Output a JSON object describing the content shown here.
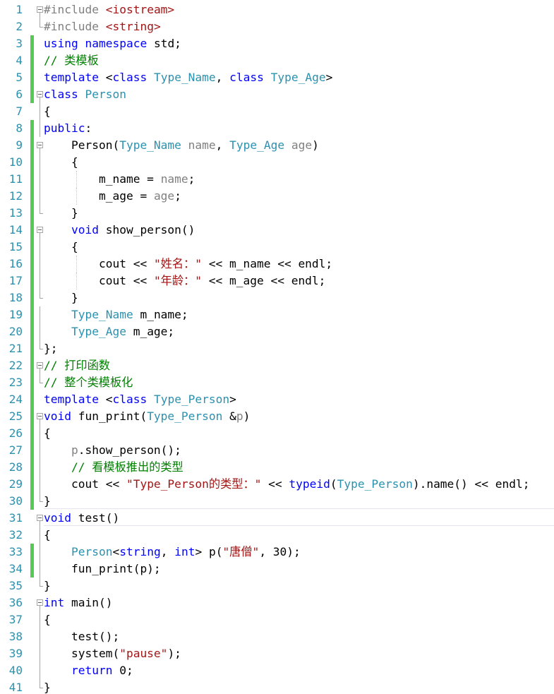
{
  "editor": {
    "lines": [
      {
        "n": "1",
        "changed": false,
        "fold": "box",
        "parts": [
          {
            "c": "pp",
            "t": "#include "
          },
          {
            "c": "str",
            "t": "<iostream>"
          }
        ]
      },
      {
        "n": "2",
        "changed": false,
        "fold": "end",
        "parts": [
          {
            "c": "pp",
            "t": "#include "
          },
          {
            "c": "str",
            "t": "<string>"
          }
        ]
      },
      {
        "n": "3",
        "changed": true,
        "fold": "",
        "parts": [
          {
            "c": "kw",
            "t": "using"
          },
          {
            "c": "",
            "t": " "
          },
          {
            "c": "kw",
            "t": "namespace"
          },
          {
            "c": "",
            "t": " std;"
          }
        ]
      },
      {
        "n": "4",
        "changed": true,
        "fold": "",
        "parts": [
          {
            "c": "cm",
            "t": "// 类模板"
          }
        ]
      },
      {
        "n": "5",
        "changed": true,
        "fold": "",
        "parts": [
          {
            "c": "kw",
            "t": "template"
          },
          {
            "c": "",
            "t": " <"
          },
          {
            "c": "kw",
            "t": "class"
          },
          {
            "c": "",
            "t": " "
          },
          {
            "c": "ty",
            "t": "Type_Name"
          },
          {
            "c": "",
            "t": ", "
          },
          {
            "c": "kw",
            "t": "class"
          },
          {
            "c": "",
            "t": " "
          },
          {
            "c": "ty",
            "t": "Type_Age"
          },
          {
            "c": "",
            "t": ">"
          }
        ]
      },
      {
        "n": "6",
        "changed": true,
        "fold": "box",
        "parts": [
          {
            "c": "kw",
            "t": "class"
          },
          {
            "c": "",
            "t": " "
          },
          {
            "c": "ty",
            "t": "Person"
          }
        ]
      },
      {
        "n": "7",
        "changed": false,
        "fold": "line",
        "parts": [
          {
            "c": "",
            "t": "{"
          }
        ]
      },
      {
        "n": "8",
        "changed": true,
        "fold": "line",
        "parts": [
          {
            "c": "kw",
            "t": "public"
          },
          {
            "c": "",
            "t": ":"
          }
        ]
      },
      {
        "n": "9",
        "changed": true,
        "fold": "box",
        "parts": [
          {
            "c": "",
            "t": "    Person("
          },
          {
            "c": "ty",
            "t": "Type_Name"
          },
          {
            "c": "",
            "t": " "
          },
          {
            "c": "pa",
            "t": "name"
          },
          {
            "c": "",
            "t": ", "
          },
          {
            "c": "ty",
            "t": "Type_Age"
          },
          {
            "c": "",
            "t": " "
          },
          {
            "c": "pa",
            "t": "age"
          },
          {
            "c": "",
            "t": ")"
          }
        ]
      },
      {
        "n": "10",
        "changed": true,
        "fold": "line",
        "parts": [
          {
            "c": "",
            "t": "    {"
          }
        ]
      },
      {
        "n": "11",
        "changed": true,
        "fold": "line",
        "guide": 1,
        "parts": [
          {
            "c": "",
            "t": "        m_name = "
          },
          {
            "c": "pa",
            "t": "name"
          },
          {
            "c": "",
            "t": ";"
          }
        ]
      },
      {
        "n": "12",
        "changed": true,
        "fold": "line",
        "guide": 1,
        "parts": [
          {
            "c": "",
            "t": "        m_age = "
          },
          {
            "c": "pa",
            "t": "age"
          },
          {
            "c": "",
            "t": ";"
          }
        ]
      },
      {
        "n": "13",
        "changed": true,
        "fold": "end",
        "parts": [
          {
            "c": "",
            "t": "    }"
          }
        ]
      },
      {
        "n": "14",
        "changed": true,
        "fold": "box",
        "parts": [
          {
            "c": "",
            "t": "    "
          },
          {
            "c": "kw",
            "t": "void"
          },
          {
            "c": "",
            "t": " show_person()"
          }
        ]
      },
      {
        "n": "15",
        "changed": true,
        "fold": "line",
        "parts": [
          {
            "c": "",
            "t": "    {"
          }
        ]
      },
      {
        "n": "16",
        "changed": true,
        "fold": "line",
        "guide": 1,
        "parts": [
          {
            "c": "",
            "t": "        cout << "
          },
          {
            "c": "str",
            "t": "\"姓名：\""
          },
          {
            "c": "",
            "t": " << m_name << endl;"
          }
        ]
      },
      {
        "n": "17",
        "changed": true,
        "fold": "line",
        "guide": 1,
        "parts": [
          {
            "c": "",
            "t": "        cout << "
          },
          {
            "c": "str",
            "t": "\"年龄：\""
          },
          {
            "c": "",
            "t": " << m_age << endl;"
          }
        ]
      },
      {
        "n": "18",
        "changed": true,
        "fold": "end",
        "parts": [
          {
            "c": "",
            "t": "    }"
          }
        ]
      },
      {
        "n": "19",
        "changed": true,
        "fold": "line",
        "parts": [
          {
            "c": "",
            "t": "    "
          },
          {
            "c": "ty",
            "t": "Type_Name"
          },
          {
            "c": "",
            "t": " m_name;"
          }
        ]
      },
      {
        "n": "20",
        "changed": true,
        "fold": "line",
        "parts": [
          {
            "c": "",
            "t": "    "
          },
          {
            "c": "ty",
            "t": "Type_Age"
          },
          {
            "c": "",
            "t": " m_age;"
          }
        ]
      },
      {
        "n": "21",
        "changed": true,
        "fold": "end",
        "parts": [
          {
            "c": "",
            "t": "};"
          }
        ]
      },
      {
        "n": "22",
        "changed": true,
        "fold": "box",
        "parts": [
          {
            "c": "cm",
            "t": "// 打印函数"
          }
        ]
      },
      {
        "n": "23",
        "changed": true,
        "fold": "end",
        "parts": [
          {
            "c": "cm",
            "t": "// 整个类模板化"
          }
        ]
      },
      {
        "n": "24",
        "changed": true,
        "fold": "",
        "parts": [
          {
            "c": "kw",
            "t": "template"
          },
          {
            "c": "",
            "t": " <"
          },
          {
            "c": "kw",
            "t": "class"
          },
          {
            "c": "",
            "t": " "
          },
          {
            "c": "ty",
            "t": "Type_Person"
          },
          {
            "c": "",
            "t": ">"
          }
        ]
      },
      {
        "n": "25",
        "changed": true,
        "fold": "box",
        "parts": [
          {
            "c": "kw",
            "t": "void"
          },
          {
            "c": "",
            "t": " fun_print("
          },
          {
            "c": "ty",
            "t": "Type_Person"
          },
          {
            "c": "",
            "t": " &"
          },
          {
            "c": "pa",
            "t": "p"
          },
          {
            "c": "",
            "t": ")"
          }
        ]
      },
      {
        "n": "26",
        "changed": true,
        "fold": "line",
        "parts": [
          {
            "c": "",
            "t": "{"
          }
        ]
      },
      {
        "n": "27",
        "changed": true,
        "fold": "line",
        "parts": [
          {
            "c": "",
            "t": "    "
          },
          {
            "c": "pa",
            "t": "p"
          },
          {
            "c": "",
            "t": ".show_person();"
          }
        ]
      },
      {
        "n": "28",
        "changed": true,
        "fold": "line",
        "parts": [
          {
            "c": "",
            "t": "    "
          },
          {
            "c": "cm",
            "t": "// 看模板推出的类型"
          }
        ]
      },
      {
        "n": "29",
        "changed": true,
        "fold": "line",
        "parts": [
          {
            "c": "",
            "t": "    cout << "
          },
          {
            "c": "str",
            "t": "\"Type_Person的类型：\""
          },
          {
            "c": "",
            "t": " << "
          },
          {
            "c": "kw",
            "t": "typeid"
          },
          {
            "c": "",
            "t": "("
          },
          {
            "c": "ty",
            "t": "Type_Person"
          },
          {
            "c": "",
            "t": ").name() << endl;"
          }
        ]
      },
      {
        "n": "30",
        "changed": true,
        "fold": "end",
        "parts": [
          {
            "c": "",
            "t": "}"
          }
        ]
      },
      {
        "n": "31",
        "changed": false,
        "fold": "box",
        "parts": [
          {
            "c": "kw",
            "t": "void"
          },
          {
            "c": "",
            "t": " test()"
          }
        ]
      },
      {
        "n": "32",
        "changed": false,
        "fold": "line",
        "parts": [
          {
            "c": "",
            "t": "{"
          }
        ]
      },
      {
        "n": "33",
        "changed": true,
        "fold": "line",
        "parts": [
          {
            "c": "",
            "t": "    "
          },
          {
            "c": "ty",
            "t": "Person"
          },
          {
            "c": "",
            "t": "<"
          },
          {
            "c": "kw",
            "t": "string"
          },
          {
            "c": "",
            "t": ", "
          },
          {
            "c": "kw",
            "t": "int"
          },
          {
            "c": "",
            "t": "> p("
          },
          {
            "c": "str",
            "t": "\"唐僧\""
          },
          {
            "c": "",
            "t": ", 30);"
          }
        ]
      },
      {
        "n": "34",
        "changed": true,
        "fold": "line",
        "parts": [
          {
            "c": "",
            "t": "    fun_print(p);"
          }
        ]
      },
      {
        "n": "35",
        "changed": false,
        "fold": "end",
        "parts": [
          {
            "c": "",
            "t": "}"
          }
        ]
      },
      {
        "n": "36",
        "changed": false,
        "fold": "box",
        "parts": [
          {
            "c": "kw",
            "t": "int"
          },
          {
            "c": "",
            "t": " main()"
          }
        ]
      },
      {
        "n": "37",
        "changed": false,
        "fold": "line",
        "parts": [
          {
            "c": "",
            "t": "{"
          }
        ]
      },
      {
        "n": "38",
        "changed": false,
        "fold": "line",
        "parts": [
          {
            "c": "",
            "t": "    test();"
          }
        ]
      },
      {
        "n": "39",
        "changed": false,
        "fold": "line",
        "parts": [
          {
            "c": "",
            "t": "    system("
          },
          {
            "c": "str",
            "t": "\"pause\""
          },
          {
            "c": "",
            "t": ");"
          }
        ]
      },
      {
        "n": "40",
        "changed": false,
        "fold": "line",
        "parts": [
          {
            "c": "",
            "t": "    "
          },
          {
            "c": "kw",
            "t": "return"
          },
          {
            "c": "",
            "t": " 0;"
          }
        ]
      },
      {
        "n": "41",
        "changed": false,
        "fold": "end",
        "parts": [
          {
            "c": "",
            "t": "}"
          }
        ]
      }
    ]
  }
}
